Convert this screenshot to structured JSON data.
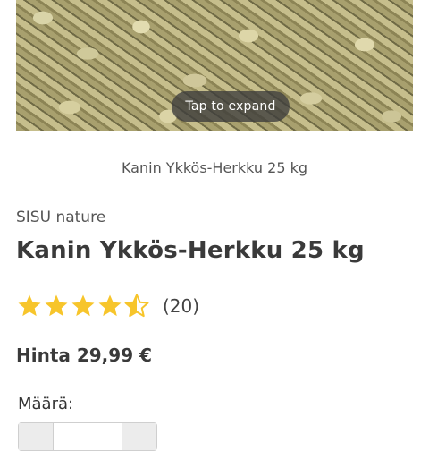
{
  "image": {
    "tap_hint": "Tap to expand"
  },
  "caption": "Kanin Ykkös-Herkku 25 kg",
  "product": {
    "brand": "SISU nature",
    "title": "Kanin Ykkös-Herkku 25 kg",
    "rating": {
      "value": 4.5,
      "max": 5,
      "count_text": "(20)"
    },
    "price": "Hinta 29,99 €"
  },
  "quantity": {
    "label": "Määrä:"
  },
  "colors": {
    "star": "#f7c52b",
    "text": "#3a3a3a"
  }
}
